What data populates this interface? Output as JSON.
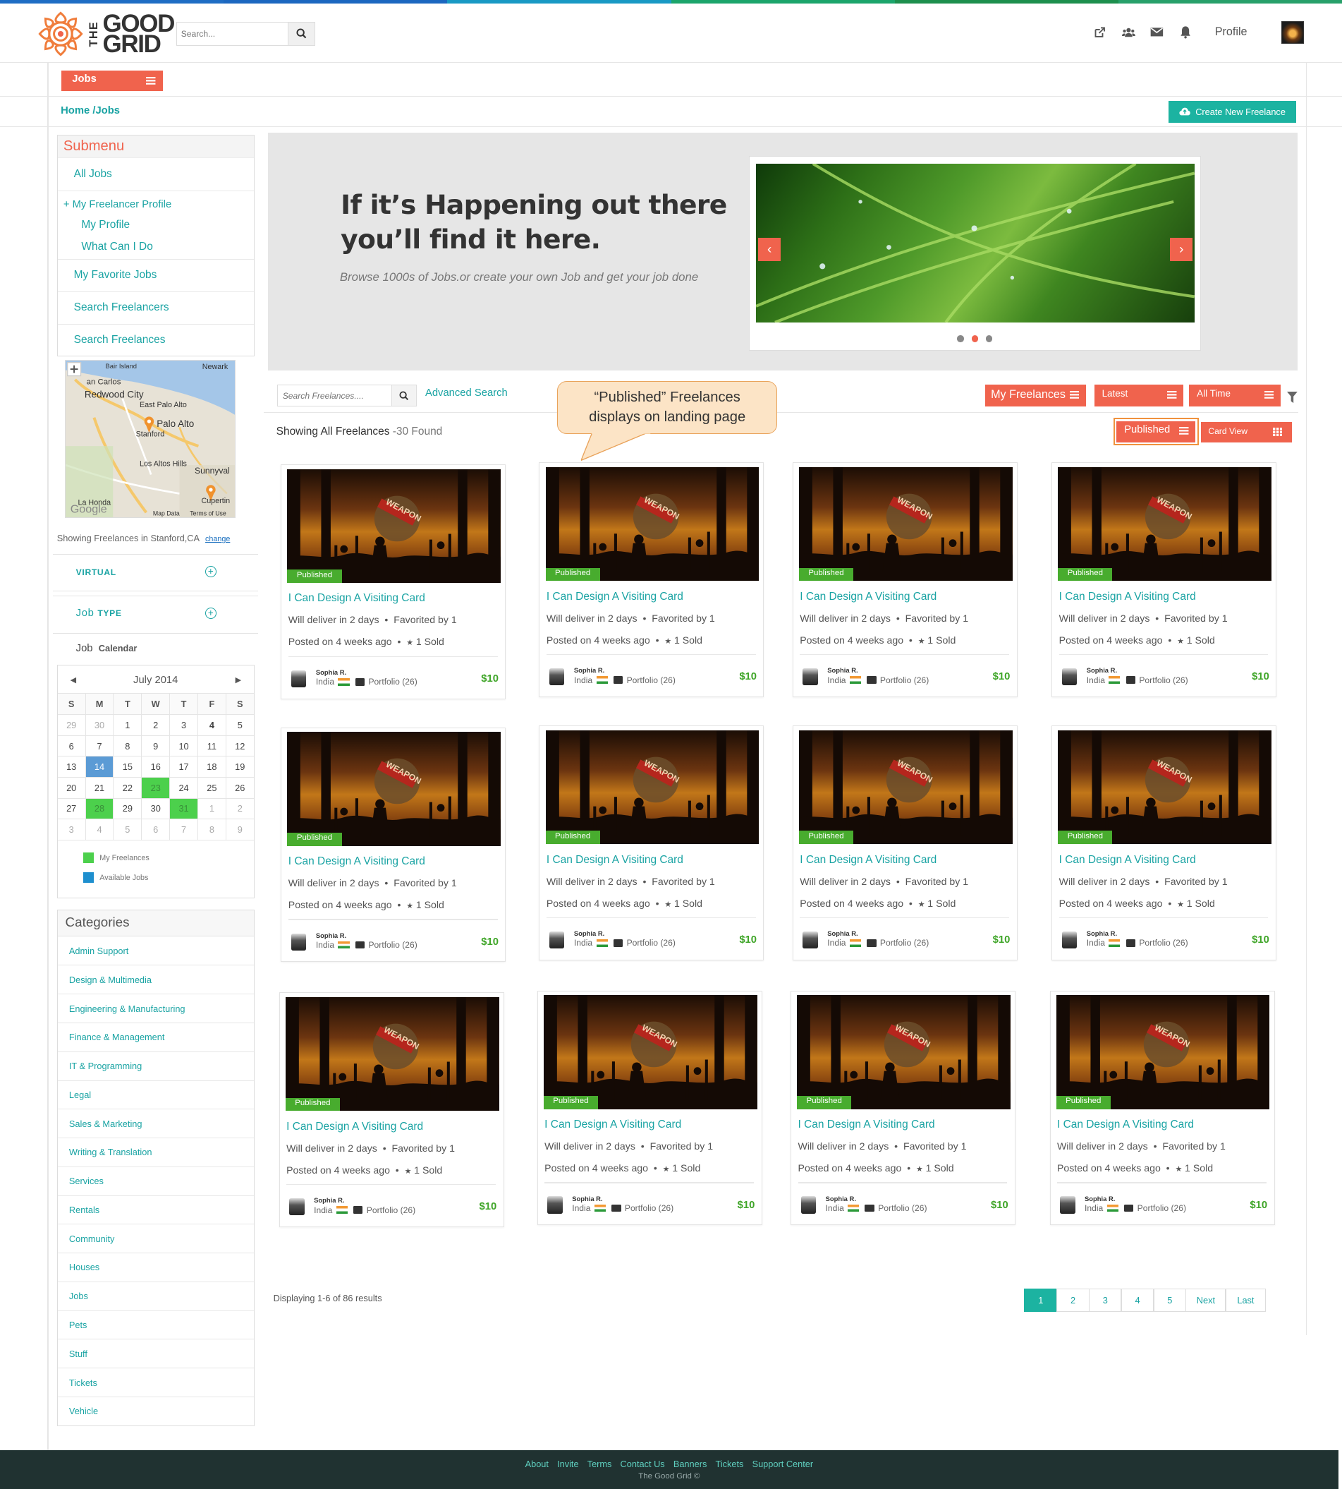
{
  "brand": {
    "logo_the": "THE",
    "logo_good": "GOOD",
    "logo_grid": "GRID"
  },
  "header": {
    "search_placeholder": "Search...",
    "profile_label": "Profile",
    "icons": [
      "external-link-icon",
      "users-icon",
      "mail-icon",
      "bell-icon"
    ]
  },
  "nav": {
    "jobs_label": "Jobs"
  },
  "breadcrumb": "Home /Jobs",
  "create_button": "Create New Freelance",
  "submenu": {
    "title": "Submenu",
    "all_jobs": "All Jobs",
    "freelancer_profile": "+ My Freelancer Profile",
    "my_profile": "My Profile",
    "what_can_i_do": "What Can I Do",
    "favorite_jobs": "My Favorite Jobs",
    "search_freelancers": "Search Freelancers",
    "search_freelances": "Search Freelances"
  },
  "map": {
    "labels": [
      "Bair Island",
      "Newark",
      "an Carlos",
      "Redwood City",
      "East Palo Alto",
      "Palo Alto",
      "Stanford",
      "Los Altos Hills",
      "Sunnyval",
      "La Honda",
      "Cupertin",
      "Google",
      "Map Data",
      "Terms of Use"
    ],
    "note": "Showing Freelances in Stanford,CA",
    "change": "change"
  },
  "filters": {
    "virtual": "VIRTUAL",
    "job_type_a": "Job",
    "job_type_b": "TYPE",
    "job_cal_a": "Job",
    "job_cal_b": "Calendar"
  },
  "calendar": {
    "month": "July 2014",
    "days": [
      "S",
      "M",
      "T",
      "W",
      "T",
      "F",
      "S"
    ],
    "weeks": [
      [
        "29",
        "30",
        "1",
        "2",
        "3",
        "4",
        "5"
      ],
      [
        "6",
        "7",
        "8",
        "9",
        "10",
        "11",
        "12"
      ],
      [
        "13",
        "14",
        "15",
        "16",
        "17",
        "18",
        "19"
      ],
      [
        "20",
        "21",
        "22",
        "23",
        "24",
        "25",
        "26"
      ],
      [
        "27",
        "28",
        "29",
        "30",
        "31",
        "1",
        "2"
      ],
      [
        "3",
        "4",
        "5",
        "6",
        "7",
        "8",
        "9"
      ]
    ],
    "legend_freelances": "My Freelances",
    "legend_available": "Available Jobs",
    "colors": {
      "my_freelances": "#4cd04c",
      "available_jobs": "#1e8fce"
    }
  },
  "categories": {
    "title": "Categories",
    "items": [
      "Admin Support",
      "Design & Multimedia",
      "Engineering & Manufacturing",
      "Finance & Management",
      "IT & Programming",
      "Legal",
      "Sales & Marketing",
      "Writing & Translation",
      "Services",
      "Rentals",
      "Community",
      "Houses",
      "Jobs",
      "Pets",
      "Stuff",
      "Tickets",
      "Vehicle"
    ]
  },
  "hero": {
    "heading_line1": "If it’s Happening out there",
    "heading_line2": "you’ll find it here.",
    "sub": "Browse 1000s of Jobs.or create your own Job and get your job done"
  },
  "toolbar": {
    "search_placeholder": "Search Freelances....",
    "advanced_search": "Advanced Search",
    "my_freelances": "My Freelances",
    "latest": "Latest",
    "all_time": "All Time",
    "showing": "Showing All Freelances",
    "found": "-30 Found",
    "published": "Published",
    "card_view": "Card View"
  },
  "callout": {
    "line1": "“Published” Freelances",
    "line2": "displays on landing page"
  },
  "card": {
    "badge": "Published",
    "title": "I Can Design A Visiting Card",
    "deliver": "Will deliver in 2 days",
    "favorited": "Favorited by 1",
    "posted": "Posted on 4 weeks ago",
    "sold": "1 Sold",
    "seller": "Sophia R.",
    "country": "India",
    "portfolio": "Portfolio (26)",
    "price": "$10",
    "poster_text": "WEAPON"
  },
  "pagination": {
    "display": "Displaying 1-6 of 86 results",
    "pages": [
      "1",
      "2",
      "3",
      "4",
      "5",
      "Next",
      "Last"
    ]
  },
  "footer": {
    "links": [
      "About",
      "Invite",
      "Terms",
      "Contact Us",
      "Banners",
      "Tickets",
      "Support Center"
    ],
    "copyright": "The Good Grid ©"
  },
  "colors": {
    "accent": "#f0634d",
    "teal": "#19a3a3",
    "published": "#48ac2e",
    "footer_bg": "#203231"
  }
}
